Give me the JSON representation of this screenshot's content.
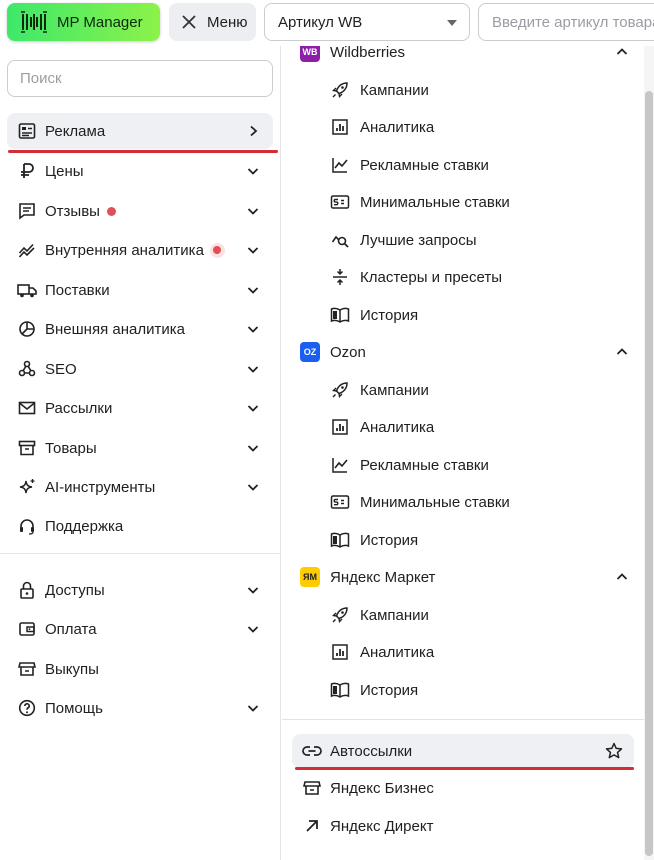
{
  "header": {
    "app_name": "MP Manager",
    "menu_label": "Меню",
    "marketplace_select": "Артикул WB",
    "article_placeholder": "Введите артикул товара"
  },
  "sidebar": {
    "search_placeholder": "Поиск",
    "items": [
      {
        "label": "Реклама",
        "icon": "ad-board-icon",
        "active": true
      },
      {
        "label": "Цены",
        "icon": "ruble-icon"
      },
      {
        "label": "Отзывы",
        "icon": "comment-icon",
        "badge": "red-dot"
      },
      {
        "label": "Внутренняя аналитика",
        "icon": "trend-icon",
        "badge": "red-dot-ring"
      },
      {
        "label": "Поставки",
        "icon": "truck-icon"
      },
      {
        "label": "Внешняя аналитика",
        "icon": "pie-icon"
      },
      {
        "label": "SEO",
        "icon": "seo-nodes-icon"
      },
      {
        "label": "Рассылки",
        "icon": "mail-icon"
      },
      {
        "label": "Товары",
        "icon": "box-icon"
      },
      {
        "label": "AI-инструменты",
        "icon": "sparkle-icon"
      },
      {
        "label": "Поддержка",
        "icon": "headset-icon"
      },
      {
        "label": "Доступы",
        "icon": "lock-icon"
      },
      {
        "label": "Оплата",
        "icon": "wallet-icon"
      },
      {
        "label": "Выкупы",
        "icon": "store-icon"
      },
      {
        "label": "Помощь",
        "icon": "help-icon"
      }
    ]
  },
  "submenu": {
    "groups": [
      {
        "title": "Wildberries",
        "badge": "WB",
        "badge_color": "#8b1fa8",
        "items": [
          {
            "label": "Кампании",
            "icon": "rocket-icon"
          },
          {
            "label": "Аналитика",
            "icon": "bar-chart-icon"
          },
          {
            "label": "Рекламные ставки",
            "icon": "line-chart-icon"
          },
          {
            "label": "Минимальные ставки",
            "icon": "price-tag-icon"
          },
          {
            "label": "Лучшие запросы",
            "icon": "search-trend-icon"
          },
          {
            "label": "Кластеры и пресеты",
            "icon": "cluster-icon"
          },
          {
            "label": "История",
            "icon": "book-icon"
          }
        ]
      },
      {
        "title": "Ozon",
        "badge": "OZ",
        "badge_color": "#1a5ff0",
        "items": [
          {
            "label": "Кампании",
            "icon": "rocket-icon"
          },
          {
            "label": "Аналитика",
            "icon": "bar-chart-icon"
          },
          {
            "label": "Рекламные ставки",
            "icon": "line-chart-icon"
          },
          {
            "label": "Минимальные ставки",
            "icon": "price-tag-icon"
          },
          {
            "label": "История",
            "icon": "book-icon"
          }
        ]
      },
      {
        "title": "Яндекс Маркет",
        "badge": "ЯМ",
        "badge_color": "#ffcc00",
        "items": [
          {
            "label": "Кампании",
            "icon": "rocket-icon"
          },
          {
            "label": "Аналитика",
            "icon": "bar-chart-icon"
          },
          {
            "label": "История",
            "icon": "book-icon"
          }
        ]
      }
    ],
    "links": [
      {
        "label": "Автоссылки",
        "icon": "link-icon",
        "active": true
      },
      {
        "label": "Яндекс Бизнес",
        "icon": "store-icon"
      },
      {
        "label": "Яндекс Директ",
        "icon": "arrow-up-right-icon"
      }
    ]
  },
  "colors": {
    "accent_green": "#3ee86a",
    "highlight_red": "#d42c34"
  }
}
